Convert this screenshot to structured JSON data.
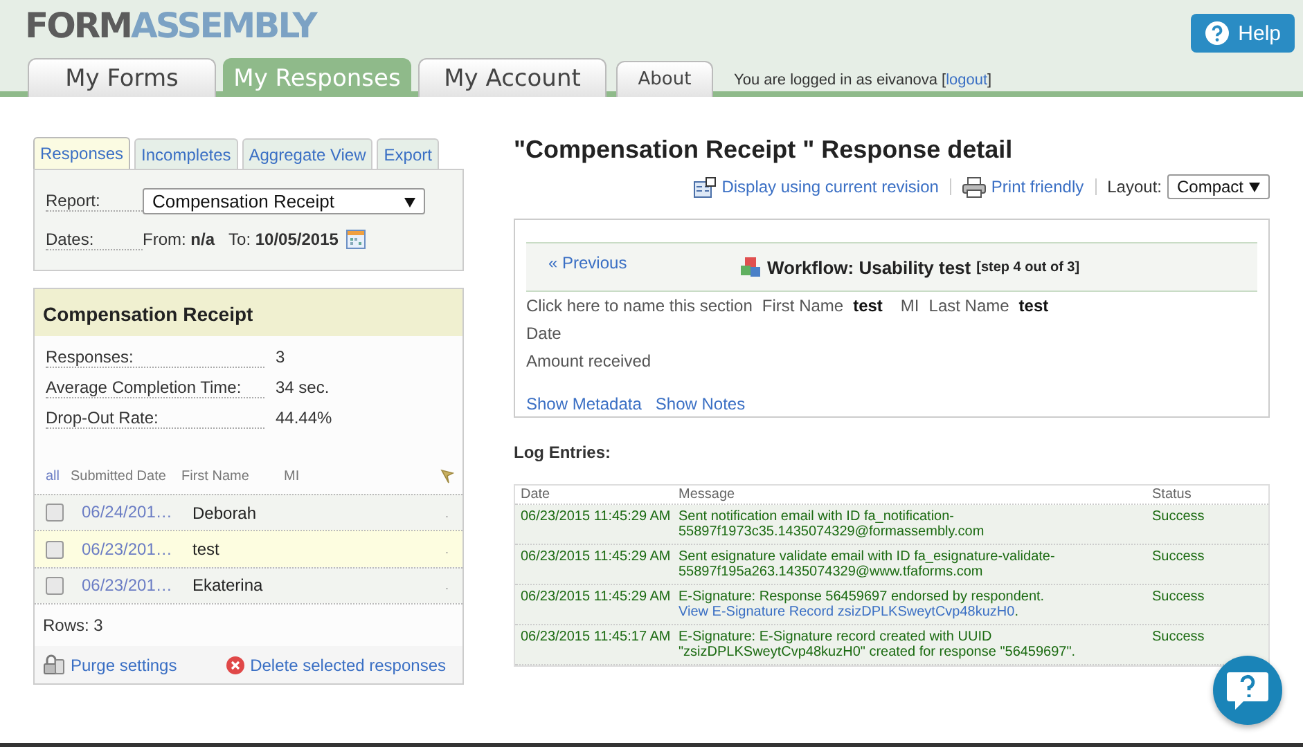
{
  "header": {
    "logo_dark": "FORM",
    "logo_light": "ASSEMBLY",
    "help": "Help",
    "tabs": [
      {
        "label": "My Forms",
        "selected": false
      },
      {
        "label": "My Responses",
        "selected": true
      },
      {
        "label": "My Account",
        "selected": false
      },
      {
        "label": "About",
        "selected": false,
        "kind": "small"
      }
    ],
    "login_text": "You are logged in as eivanova",
    "bracket_open": "[",
    "logout": "logout",
    "bracket_close": "]"
  },
  "sub_tabs": [
    {
      "label": "Responses",
      "selected": true
    },
    {
      "label": "Incompletes",
      "selected": false
    },
    {
      "label": "Aggregate View",
      "selected": false
    },
    {
      "label": "Export",
      "selected": false
    }
  ],
  "report": {
    "label": "Report:",
    "value": "Compensation Receipt",
    "dates_label": "Dates:",
    "from_label": "From:",
    "from": "n/a",
    "to_label": "To:",
    "to": "10/05/2015"
  },
  "summary": {
    "title": "Compensation Receipt",
    "stats": [
      {
        "label": "Responses:",
        "value": "3"
      },
      {
        "label": "Average Completion Time:",
        "value": "34 sec."
      },
      {
        "label": "Drop-Out Rate:",
        "value": "44.44%"
      }
    ],
    "columns": [
      "all",
      "Submitted Date",
      "First Name",
      "MI"
    ],
    "rows": [
      {
        "date": "06/24/201…",
        "first_name": "Deborah",
        "mark": ".",
        "checked": false,
        "selected": false
      },
      {
        "date": "06/23/201…",
        "first_name": "test",
        "mark": ".",
        "checked": false,
        "selected": true
      },
      {
        "date": "06/23/201…",
        "first_name": "Ekaterina",
        "mark": ".",
        "checked": false,
        "selected": false
      }
    ],
    "rows_count": "Rows: 3",
    "purge": "Purge settings",
    "delete": "Delete selected responses"
  },
  "detail": {
    "title": "\"Compensation Receipt \" Response detail",
    "revision": "Display using current revision",
    "print": "Print friendly",
    "layout_label": "Layout:",
    "layout": "Compact",
    "previous": "« Previous",
    "workflow": "Workflow: Usability test",
    "step": "[step 4 out of 3]",
    "lines": [
      [
        {
          "label": "Click here to name this section"
        },
        {
          "label": "First Name",
          "value": "test"
        },
        {
          "label": "MI"
        },
        {
          "label": "Last Name",
          "value": "test"
        }
      ],
      [
        {
          "label": "Date"
        }
      ],
      [
        {
          "label": "Amount received"
        }
      ]
    ],
    "metadata": "Show Metadata",
    "notes": "Show Notes"
  },
  "log": {
    "title": "Log Entries:",
    "columns": [
      "Date",
      "Message",
      "Status"
    ],
    "rows": [
      {
        "date": "06/23/2015 11:45:29 AM",
        "message": "Sent notification email with ID fa_notification-55897f1973c35.1435074329@formassembly.com",
        "status": "Success"
      },
      {
        "date": "06/23/2015 11:45:29 AM",
        "message": "Sent esignature validate email with ID fa_esignature-validate-55897f195a263.1435074329@www.tfaforms.com",
        "status": "Success"
      },
      {
        "date": "06/23/2015 11:45:29 AM",
        "message": "E-Signature: Response 56459697 endorsed by respondent. ",
        "link": "View E-Signature Record zsizDPLKSweytCvp48kuzH0",
        "message_end": ".",
        "status": "Success"
      },
      {
        "date": "06/23/2015 11:45:17 AM",
        "message": "E-Signature: E-Signature record created with UUID \"zsizDPLKSweytCvp48kuzH0\" created for response \"56459697\".",
        "status": "Success"
      }
    ]
  }
}
